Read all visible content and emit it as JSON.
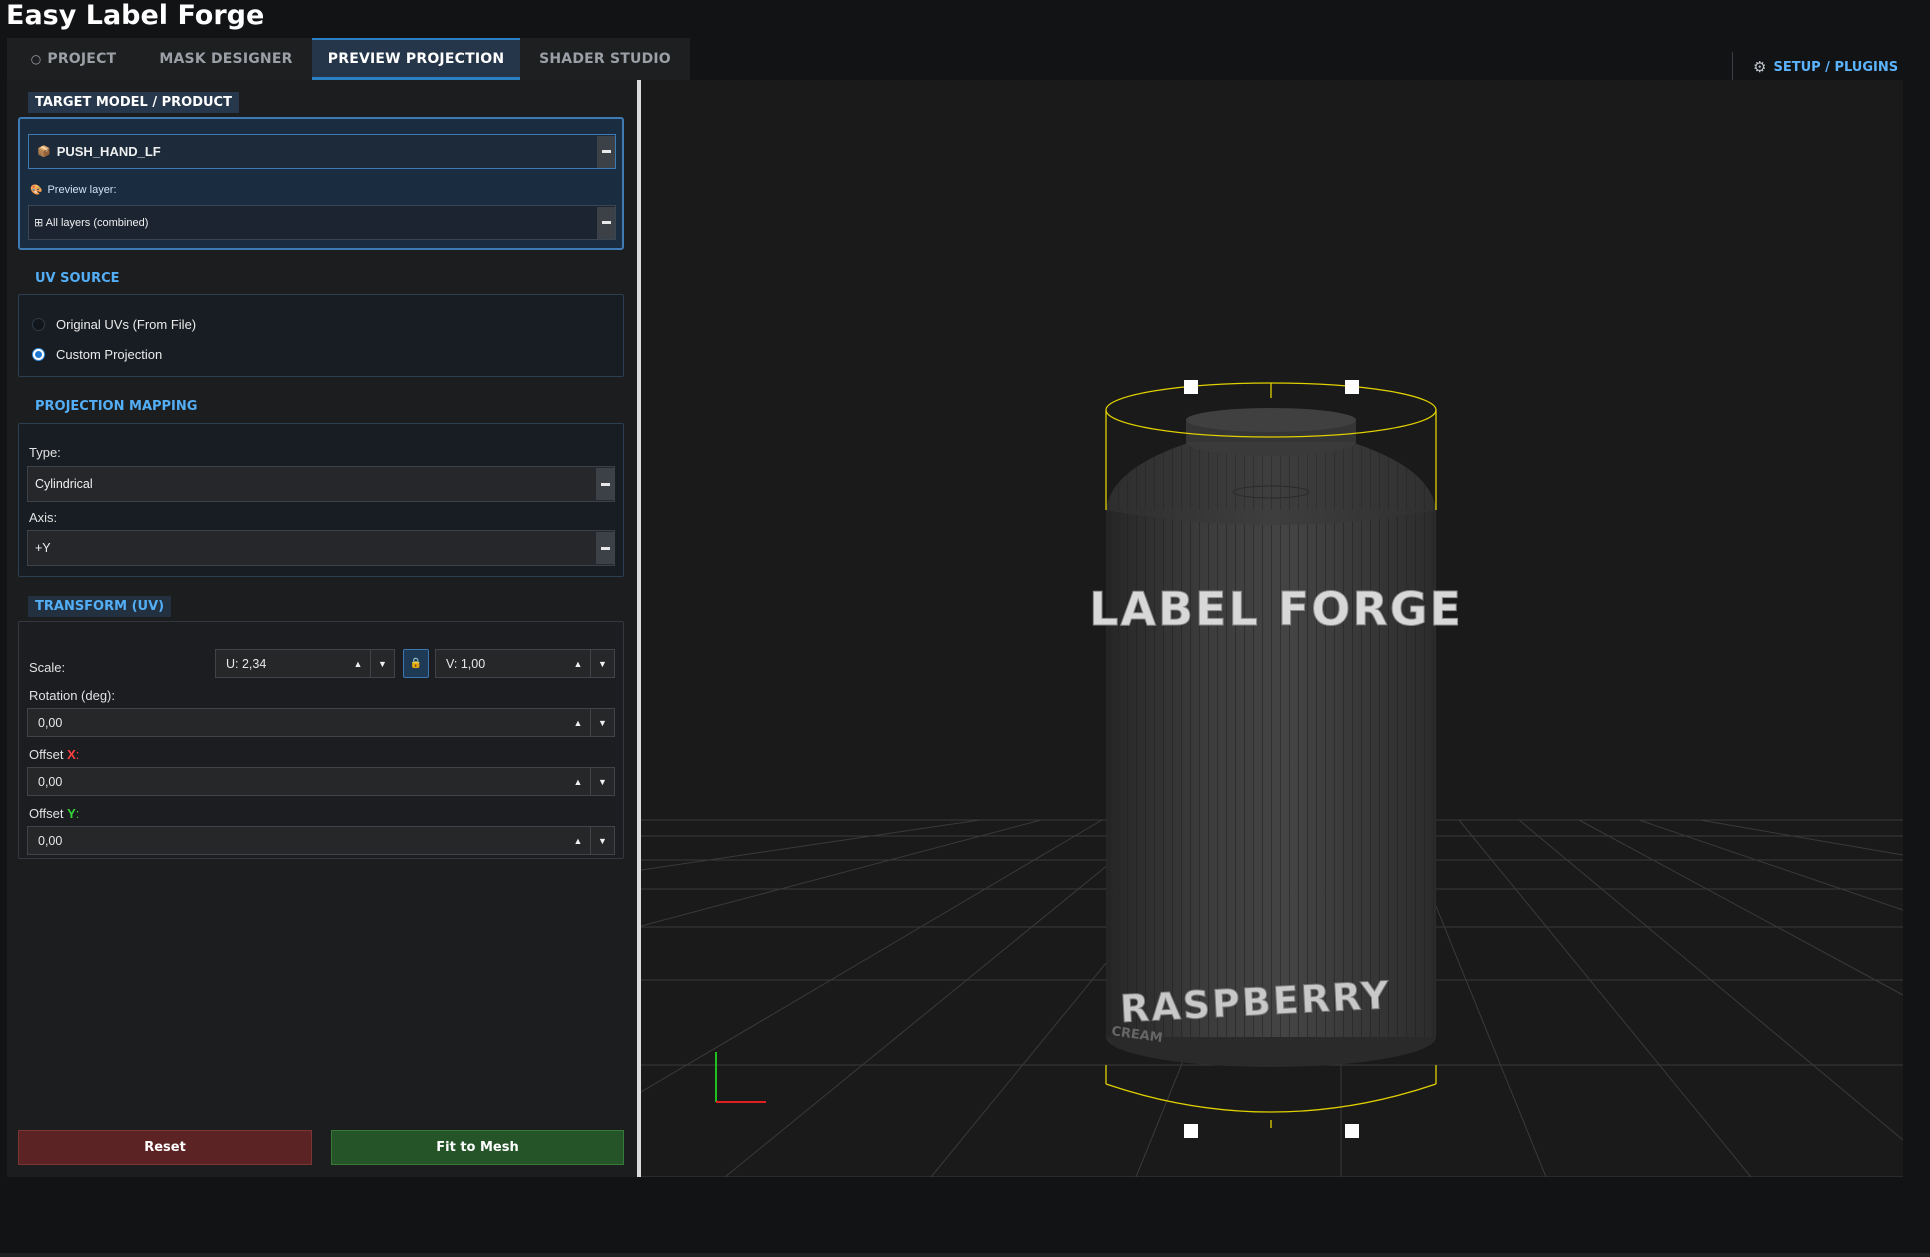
{
  "app": {
    "title": "Easy Label Forge"
  },
  "tabs": [
    {
      "label": "PROJECT",
      "icon": "○",
      "active": false
    },
    {
      "label": "MASK DESIGNER",
      "active": false
    },
    {
      "label": "PREVIEW PROJECTION",
      "active": true
    },
    {
      "label": "SHADER STUDIO",
      "active": false
    }
  ],
  "header": {
    "setup_label": "SETUP / PLUGINS",
    "setup_icon": "gear-icon"
  },
  "target": {
    "title": "TARGET MODEL / PRODUCT",
    "model_value": "PUSH_HAND_LF",
    "model_icon": "📦",
    "preview_layer_label": "Preview layer:",
    "preview_layer_icon": "🎨",
    "preview_layer_value": "⊞ All layers (combined)"
  },
  "uv_source": {
    "title": "UV SOURCE",
    "options": [
      {
        "label": "Original UVs (From File)",
        "checked": false
      },
      {
        "label": "Custom Projection",
        "checked": true
      }
    ]
  },
  "projection": {
    "title": "PROJECTION MAPPING",
    "type_label": "Type:",
    "type_value": "Cylindrical",
    "axis_label": "Axis:",
    "axis_value": "+Y"
  },
  "transform": {
    "title": "TRANSFORM (UV)",
    "scale_label": "Scale:",
    "scale_u": "U: 2,34",
    "scale_v": "V: 1,00",
    "lock_icon": "🔒",
    "rotation_label": "Rotation (deg):",
    "rotation_value": "0,00",
    "offset_x_prefix": "Offset ",
    "offset_x_axis": "X",
    "offset_x_value": "0,00",
    "offset_y_prefix": "Offset ",
    "offset_y_axis": "Y",
    "offset_y_value": "0,00",
    "colon": ":"
  },
  "actions": {
    "reset_label": "Reset",
    "fit_label": "Fit to Mesh"
  },
  "viewport": {
    "label_text_top": "LABEL FORGE",
    "label_text_bottom": "RASPBERRY",
    "label_text_small": "CREAM",
    "bbox_color": "#e0d000",
    "axis_x_color": "#e02020",
    "axis_y_color": "#20c020"
  }
}
